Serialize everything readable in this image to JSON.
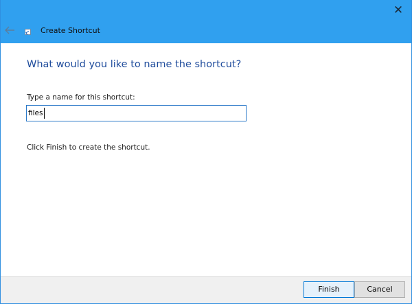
{
  "window": {
    "title": "Create Shortcut",
    "close_icon": "close-icon",
    "back_icon": "back-arrow-icon",
    "title_icon": "shortcut-icon"
  },
  "content": {
    "heading": "What would you like to name the shortcut?",
    "name_label": "Type a name for this shortcut:",
    "name_value": "files",
    "instruction": "Click Finish to create the shortcut."
  },
  "buttons": {
    "finish": "Finish",
    "cancel": "Cancel"
  },
  "colors": {
    "titlebar": "#30a0ef",
    "heading": "#1f4c9c",
    "input_border": "#2b79c8",
    "primary_button_border": "#0078d7"
  }
}
